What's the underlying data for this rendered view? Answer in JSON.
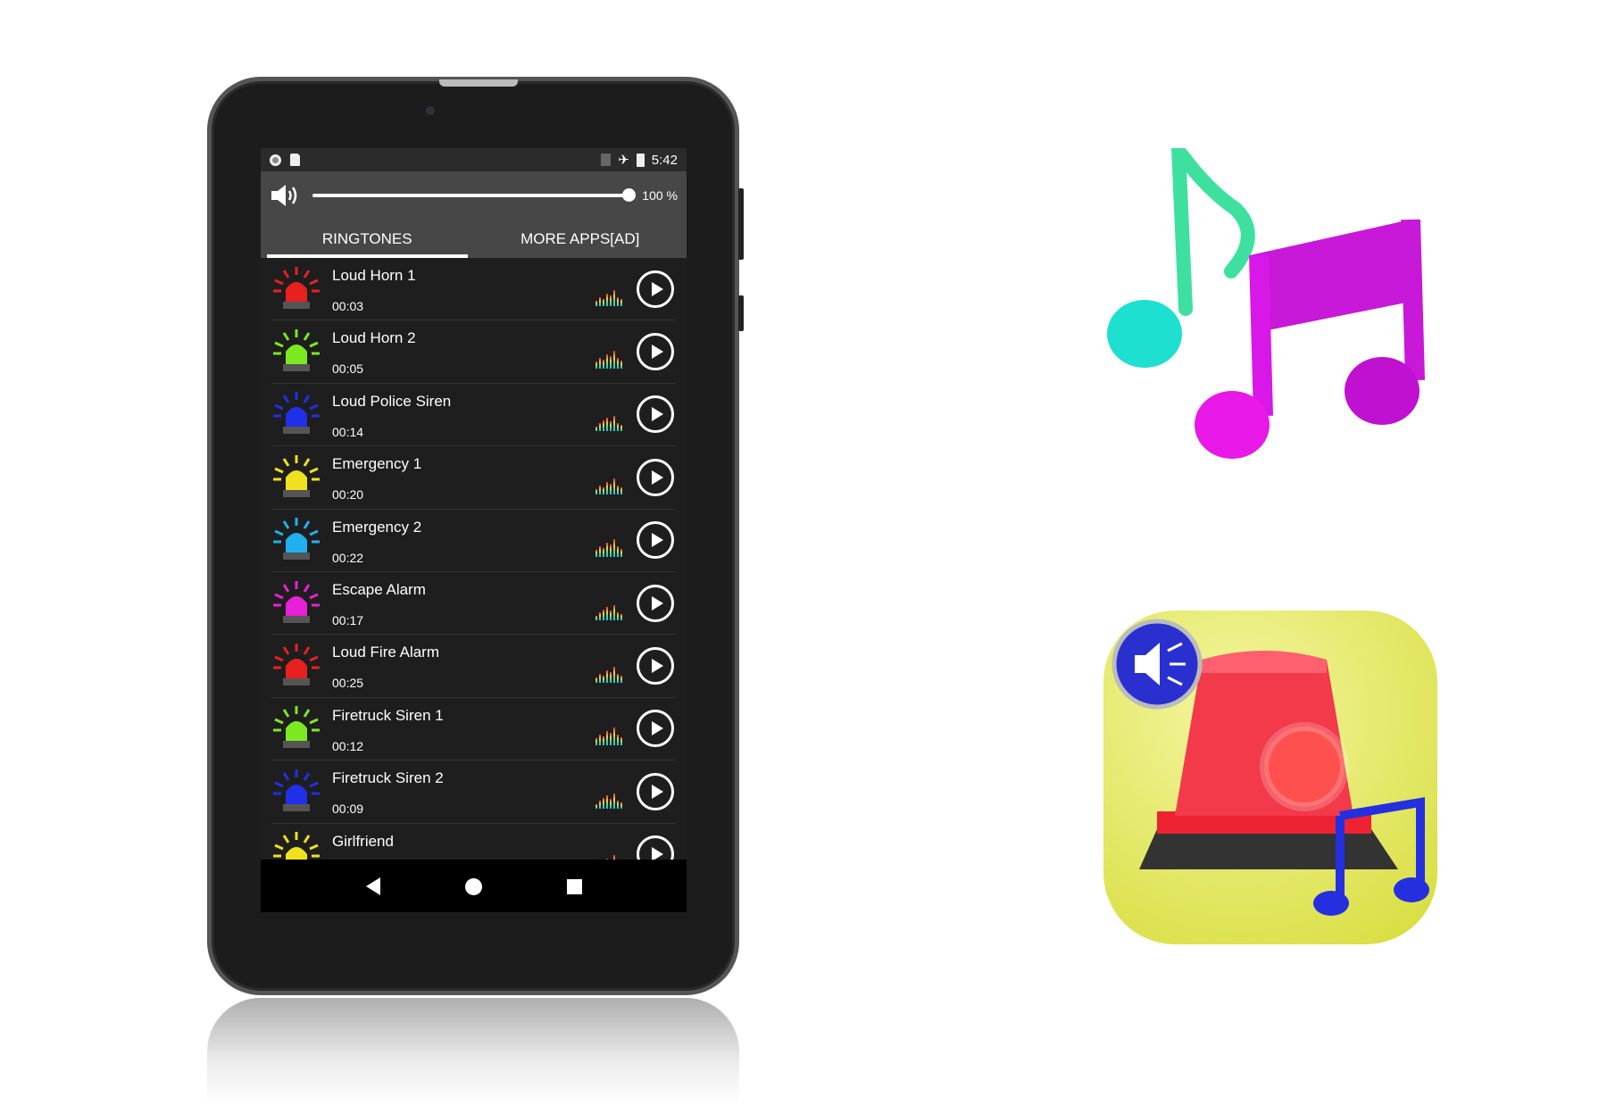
{
  "status_bar": {
    "time": "5:42",
    "icons": [
      "record-icon",
      "sd-card-icon",
      "no-sim-icon",
      "airplane-icon",
      "battery-charging-icon"
    ]
  },
  "volume": {
    "level_percent": 100,
    "label": "100 %"
  },
  "tabs": [
    {
      "label": "RINGTONES",
      "active": true
    },
    {
      "label": "MORE APPS[AD]",
      "active": false
    }
  ],
  "ringtones": [
    {
      "name": "Loud Horn 1",
      "duration": "00:03",
      "color": "#e82020"
    },
    {
      "name": "Loud Horn 2",
      "duration": "00:05",
      "color": "#7be820"
    },
    {
      "name": "Loud Police Siren",
      "duration": "00:14",
      "color": "#2030e8"
    },
    {
      "name": "Emergency 1",
      "duration": "00:20",
      "color": "#f0e020"
    },
    {
      "name": "Emergency 2",
      "duration": "00:22",
      "color": "#20b0f0"
    },
    {
      "name": "Escape Alarm",
      "duration": "00:17",
      "color": "#e820d8"
    },
    {
      "name": "Loud Fire Alarm",
      "duration": "00:25",
      "color": "#e82020"
    },
    {
      "name": "Firetruck Siren 1",
      "duration": "00:12",
      "color": "#7be820"
    },
    {
      "name": "Firetruck Siren 2",
      "duration": "00:09",
      "color": "#2030e8"
    },
    {
      "name": "Girlfriend",
      "duration": "",
      "color": "#f0e020"
    }
  ],
  "nav": [
    "back-icon",
    "home-icon",
    "recents-icon"
  ]
}
